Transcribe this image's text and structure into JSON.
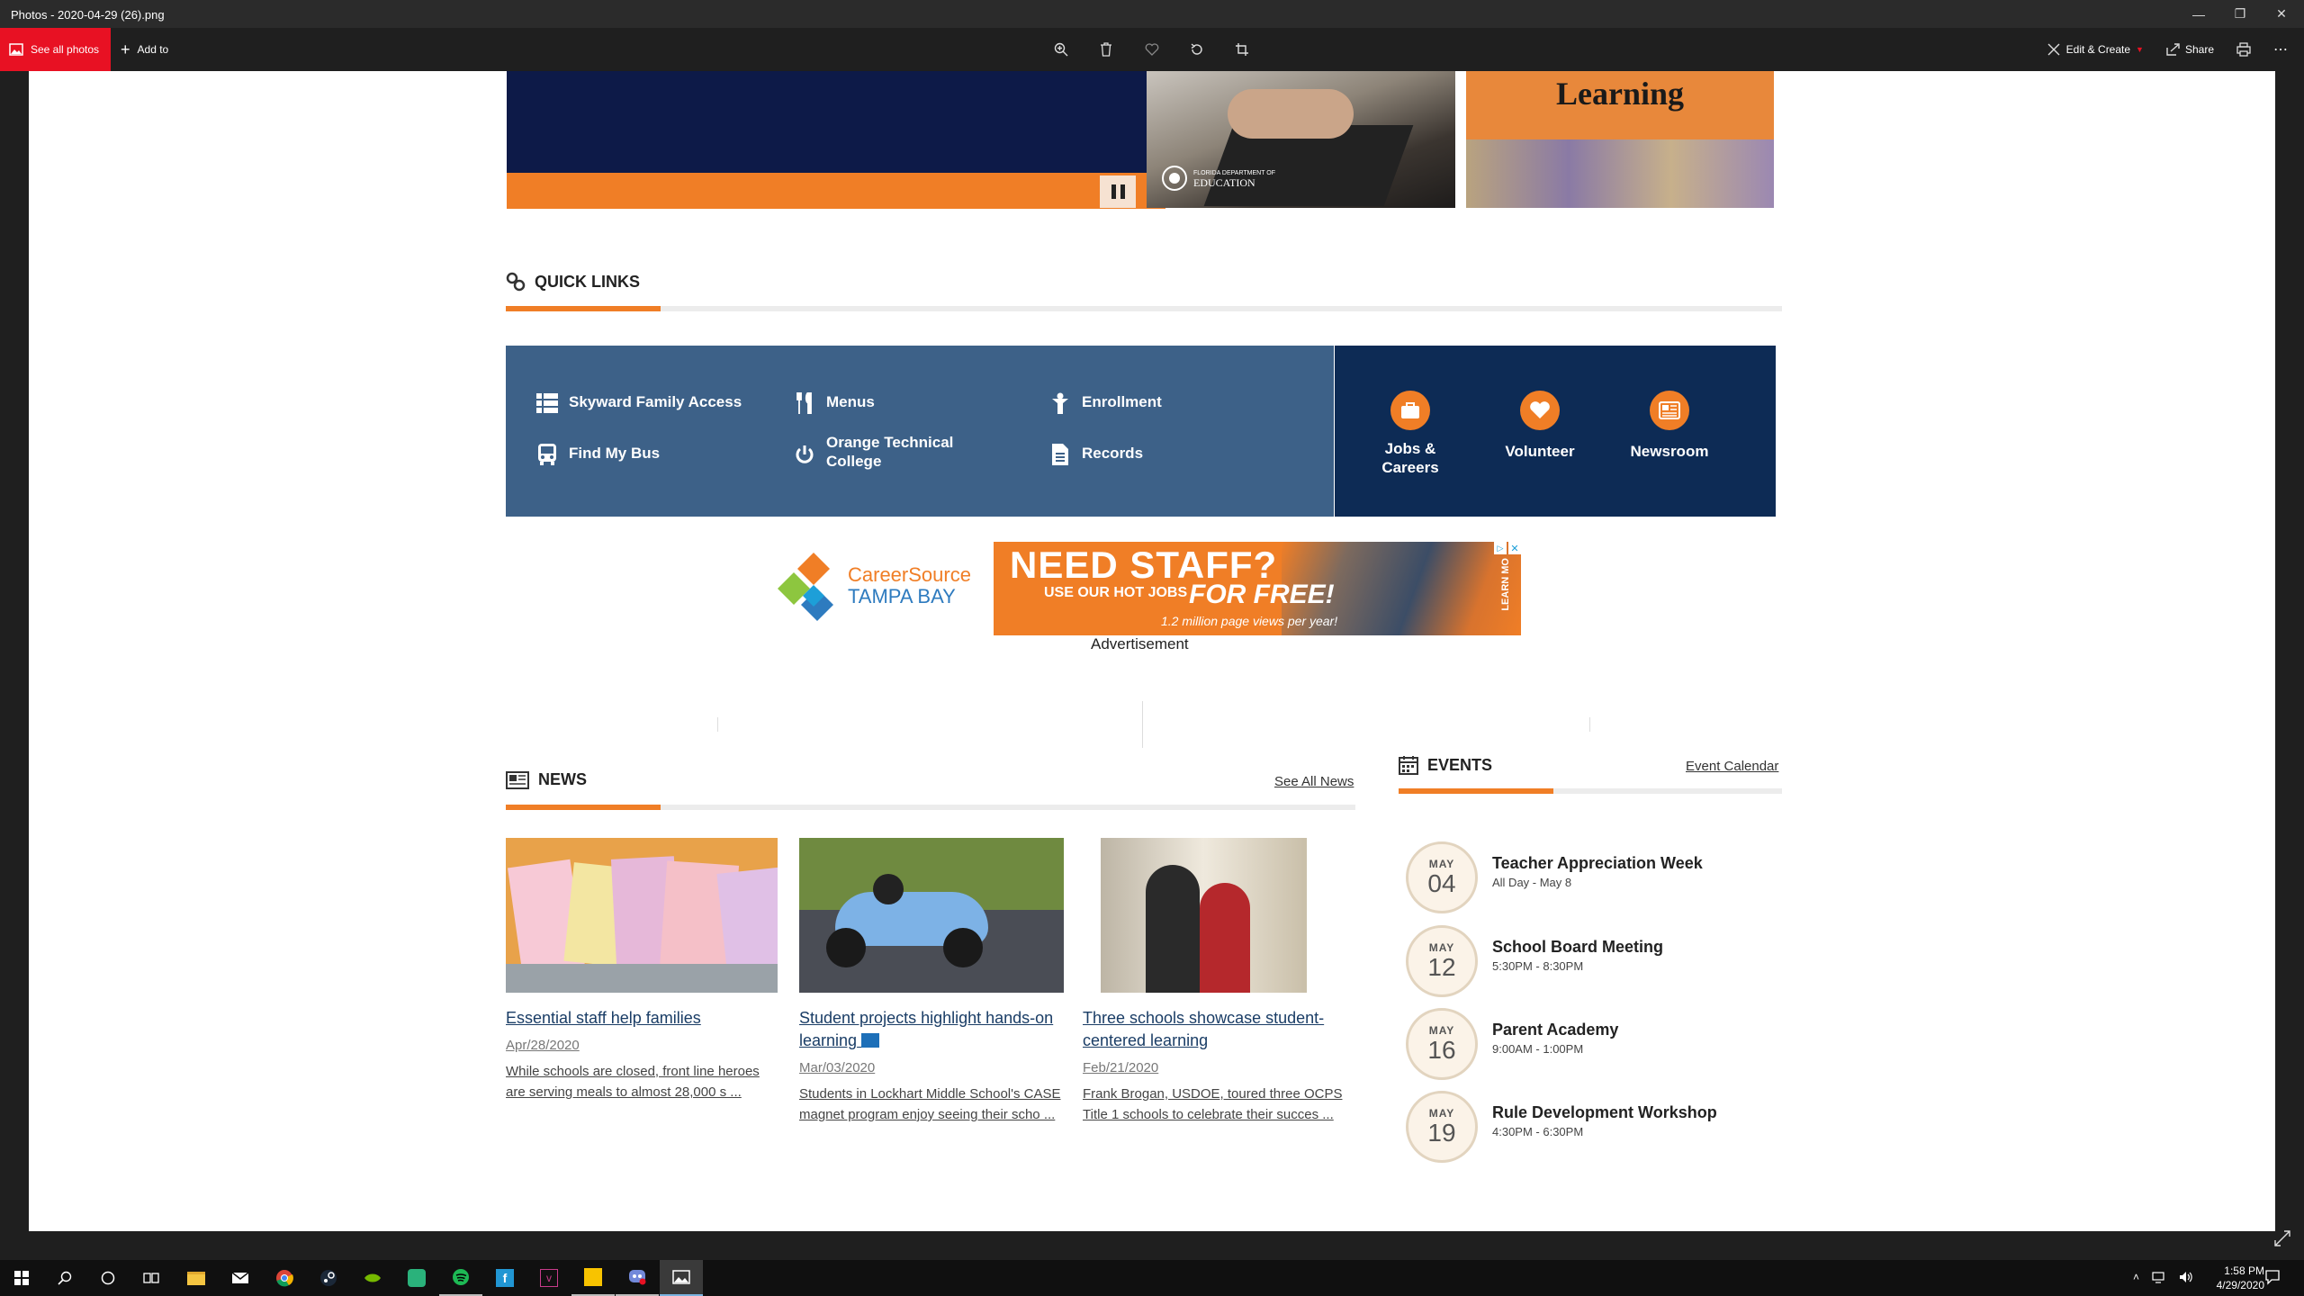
{
  "window": {
    "title": "Photos - 2020-04-29 (26).png"
  },
  "toolbar": {
    "see_all_photos": "See all photos",
    "add_to": "Add to",
    "edit_create": "Edit & Create",
    "share": "Share"
  },
  "banner": {
    "slide3_text": "Learning",
    "slide2_logo_line1": "FLORIDA DEPARTMENT OF",
    "slide2_logo_line2": "EDUCATION"
  },
  "quick_links": {
    "title": "QUICK LINKS",
    "links": [
      {
        "label": "Skyward Family Access",
        "icon": "table-icon"
      },
      {
        "label": "Menus",
        "icon": "utensils-icon"
      },
      {
        "label": "Enrollment",
        "icon": "person-icon"
      },
      {
        "label": "Find My Bus",
        "icon": "bus-icon"
      },
      {
        "label": "Orange Technical College",
        "icon": "power-icon"
      },
      {
        "label": "Records",
        "icon": "document-icon"
      }
    ],
    "featured": [
      {
        "label": "Jobs & Careers",
        "icon": "briefcase-icon"
      },
      {
        "label": "Volunteer",
        "icon": "heart-icon"
      },
      {
        "label": "Newsroom",
        "icon": "newspaper-icon"
      }
    ]
  },
  "ad": {
    "brand_line1": "CareerSource",
    "brand_line2": "TAMPA BAY",
    "headline": "NEED STAFF?",
    "sub1": "USE OUR HOT JOBS",
    "sub2": "FOR FREE!",
    "sub3": "1.2 million page views per year!",
    "learn": "LEARN MO",
    "label": "Advertisement"
  },
  "news": {
    "title": "NEWS",
    "see_all": "See All News",
    "items": [
      {
        "title": "Essential staff help families",
        "date": "Apr/28/2020",
        "desc": "While schools are closed, front line heroes are serving meals to almost 28,000 s ..."
      },
      {
        "title": "Student projects highlight hands-on learning",
        "date": "Mar/03/2020",
        "desc": "Students in Lockhart Middle School's CASE magnet program enjoy seeing their scho ..."
      },
      {
        "title": "Three schools showcase student-centered learning",
        "date": "Feb/21/2020",
        "desc": "Frank Brogan, USDOE, toured three OCPS Title 1 schools to celebrate their succes ..."
      }
    ]
  },
  "events": {
    "title": "EVENTS",
    "calendar_link": "Event Calendar",
    "items": [
      {
        "month": "MAY",
        "day": "04",
        "name": "Teacher Appreciation Week",
        "time": "All Day - May 8"
      },
      {
        "month": "MAY",
        "day": "12",
        "name": "School Board Meeting",
        "time": "5:30PM - 8:30PM"
      },
      {
        "month": "MAY",
        "day": "16",
        "name": "Parent Academy",
        "time": "9:00AM - 1:00PM"
      },
      {
        "month": "MAY",
        "day": "19",
        "name": "Rule Development Workshop",
        "time": "4:30PM - 6:30PM"
      }
    ]
  },
  "taskbar": {
    "time": "1:58 PM",
    "date": "4/29/2020"
  },
  "colors": {
    "accent": "#f07e26",
    "quick_links_bg": "#3d6188",
    "featured_bg": "#0d2b55",
    "close_red": "#e81123"
  }
}
